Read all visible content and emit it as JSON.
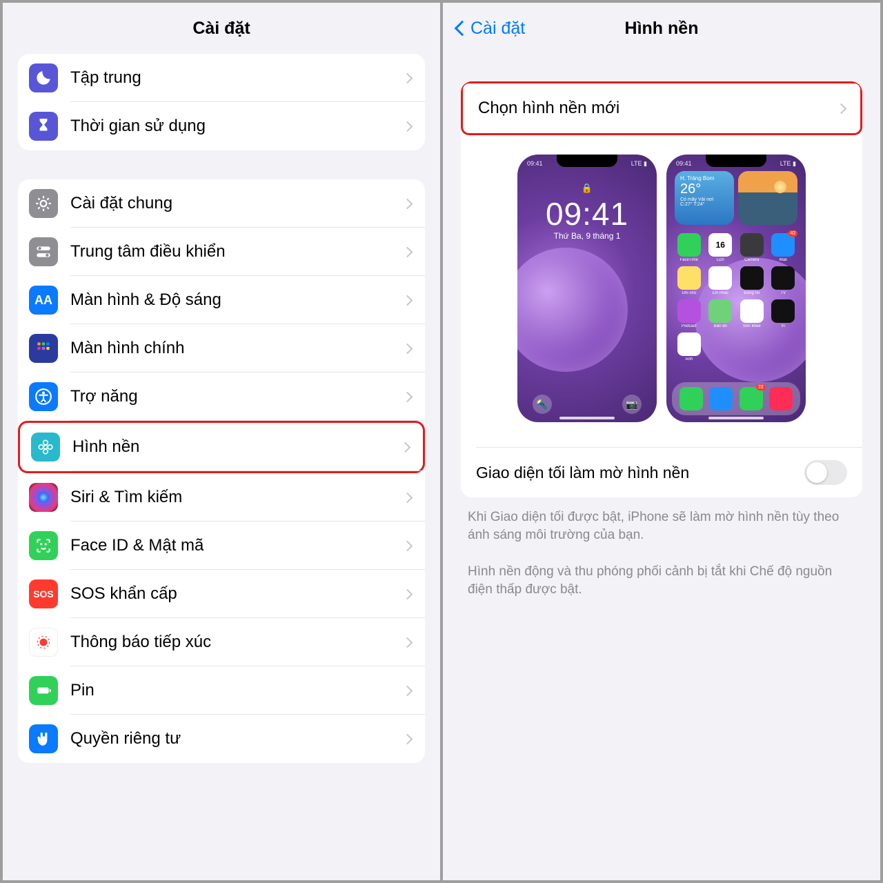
{
  "left": {
    "title": "Cài đặt",
    "groups": [
      {
        "items": [
          {
            "key": "focus",
            "label": "Tập trung",
            "icon_bg": "#5856d6",
            "icon": "moon"
          },
          {
            "key": "screentime",
            "label": "Thời gian sử dụng",
            "icon_bg": "#5856d6",
            "icon": "hourglass"
          }
        ]
      },
      {
        "items": [
          {
            "key": "general",
            "label": "Cài đặt chung",
            "icon_bg": "#8e8e93",
            "icon": "gear"
          },
          {
            "key": "control",
            "label": "Trung tâm điều khiển",
            "icon_bg": "#8e8e93",
            "icon": "toggles"
          },
          {
            "key": "display",
            "label": "Màn hình & Độ sáng",
            "icon_bg": "#0a7aff",
            "icon": "aa"
          },
          {
            "key": "home",
            "label": "Màn hình chính",
            "icon_bg": "#2b3a9e",
            "icon": "grid"
          },
          {
            "key": "access",
            "label": "Trợ năng",
            "icon_bg": "#0a7aff",
            "icon": "person"
          },
          {
            "key": "wallpaper",
            "label": "Hình nền",
            "icon_bg": "#28b9cc",
            "icon": "flower",
            "highlight": true
          },
          {
            "key": "siri",
            "label": "Siri & Tìm kiếm",
            "icon_bg": "#222",
            "icon": "siri"
          },
          {
            "key": "faceid",
            "label": "Face ID & Mật mã",
            "icon_bg": "#30d158",
            "icon": "face"
          },
          {
            "key": "sos",
            "label": "SOS khẩn cấp",
            "icon_bg": "#ff3b30",
            "icon": "sos"
          },
          {
            "key": "exposure",
            "label": "Thông báo tiếp xúc",
            "icon_bg": "#ffffff",
            "icon": "exposure"
          },
          {
            "key": "battery",
            "label": "Pin",
            "icon_bg": "#30d158",
            "icon": "battery"
          },
          {
            "key": "privacy",
            "label": "Quyền riêng tư",
            "icon_bg": "#0a7aff",
            "icon": "hand"
          }
        ]
      }
    ]
  },
  "right": {
    "back_label": "Cài đặt",
    "title": "Hình nền",
    "choose_label": "Chọn hình nền mới",
    "dark_toggle_label": "Giao diện tối làm mờ hình nền",
    "footer1": "Khi Giao diện tối được bật, iPhone sẽ làm mờ hình nền tùy theo ánh sáng môi trường của bạn.",
    "footer2": "Hình nền động và thu phóng phối cảnh bị tắt khi Chế độ nguồn điện thấp được bật.",
    "lockscreen": {
      "time": "09:41",
      "date": "Thứ Ba, 9 tháng 1",
      "status_time": "09:41",
      "status_net": "LTE"
    },
    "homescreen": {
      "status_time": "09:41",
      "status_net": "LTE",
      "weather_location": "H. Trảng Bom",
      "weather_temp": "26°",
      "weather_desc": "Có mây Vài nơi",
      "weather_range": "C:27° T:24°",
      "apps": [
        {
          "name": "FaceTime",
          "bg": "#30d158"
        },
        {
          "name": "Lịch",
          "bg": "#ffffff",
          "text": "16",
          "fg": "#000"
        },
        {
          "name": "Camera",
          "bg": "#3a3a3c"
        },
        {
          "name": "Mail",
          "bg": "#1f8fff",
          "badge": "42"
        },
        {
          "name": "Ghi chú",
          "bg": "#ffe066"
        },
        {
          "name": "Lời nhắc",
          "bg": "#ffffff"
        },
        {
          "name": "Đồng hồ",
          "bg": "#111"
        },
        {
          "name": "TV",
          "bg": "#111"
        },
        {
          "name": "Podcast",
          "bg": "#b452e0"
        },
        {
          "name": "Bản đồ",
          "bg": "#6fd27a"
        },
        {
          "name": "Sức khỏe",
          "bg": "#ffffff"
        },
        {
          "name": "Ví",
          "bg": "#111"
        },
        {
          "name": "Ảnh",
          "bg": "#ffffff"
        }
      ],
      "dock": [
        {
          "bg": "#30d158"
        },
        {
          "bg": "#1f8fff"
        },
        {
          "bg": "#30d158",
          "badge": "22"
        },
        {
          "bg": "#ff2d55"
        }
      ]
    }
  }
}
